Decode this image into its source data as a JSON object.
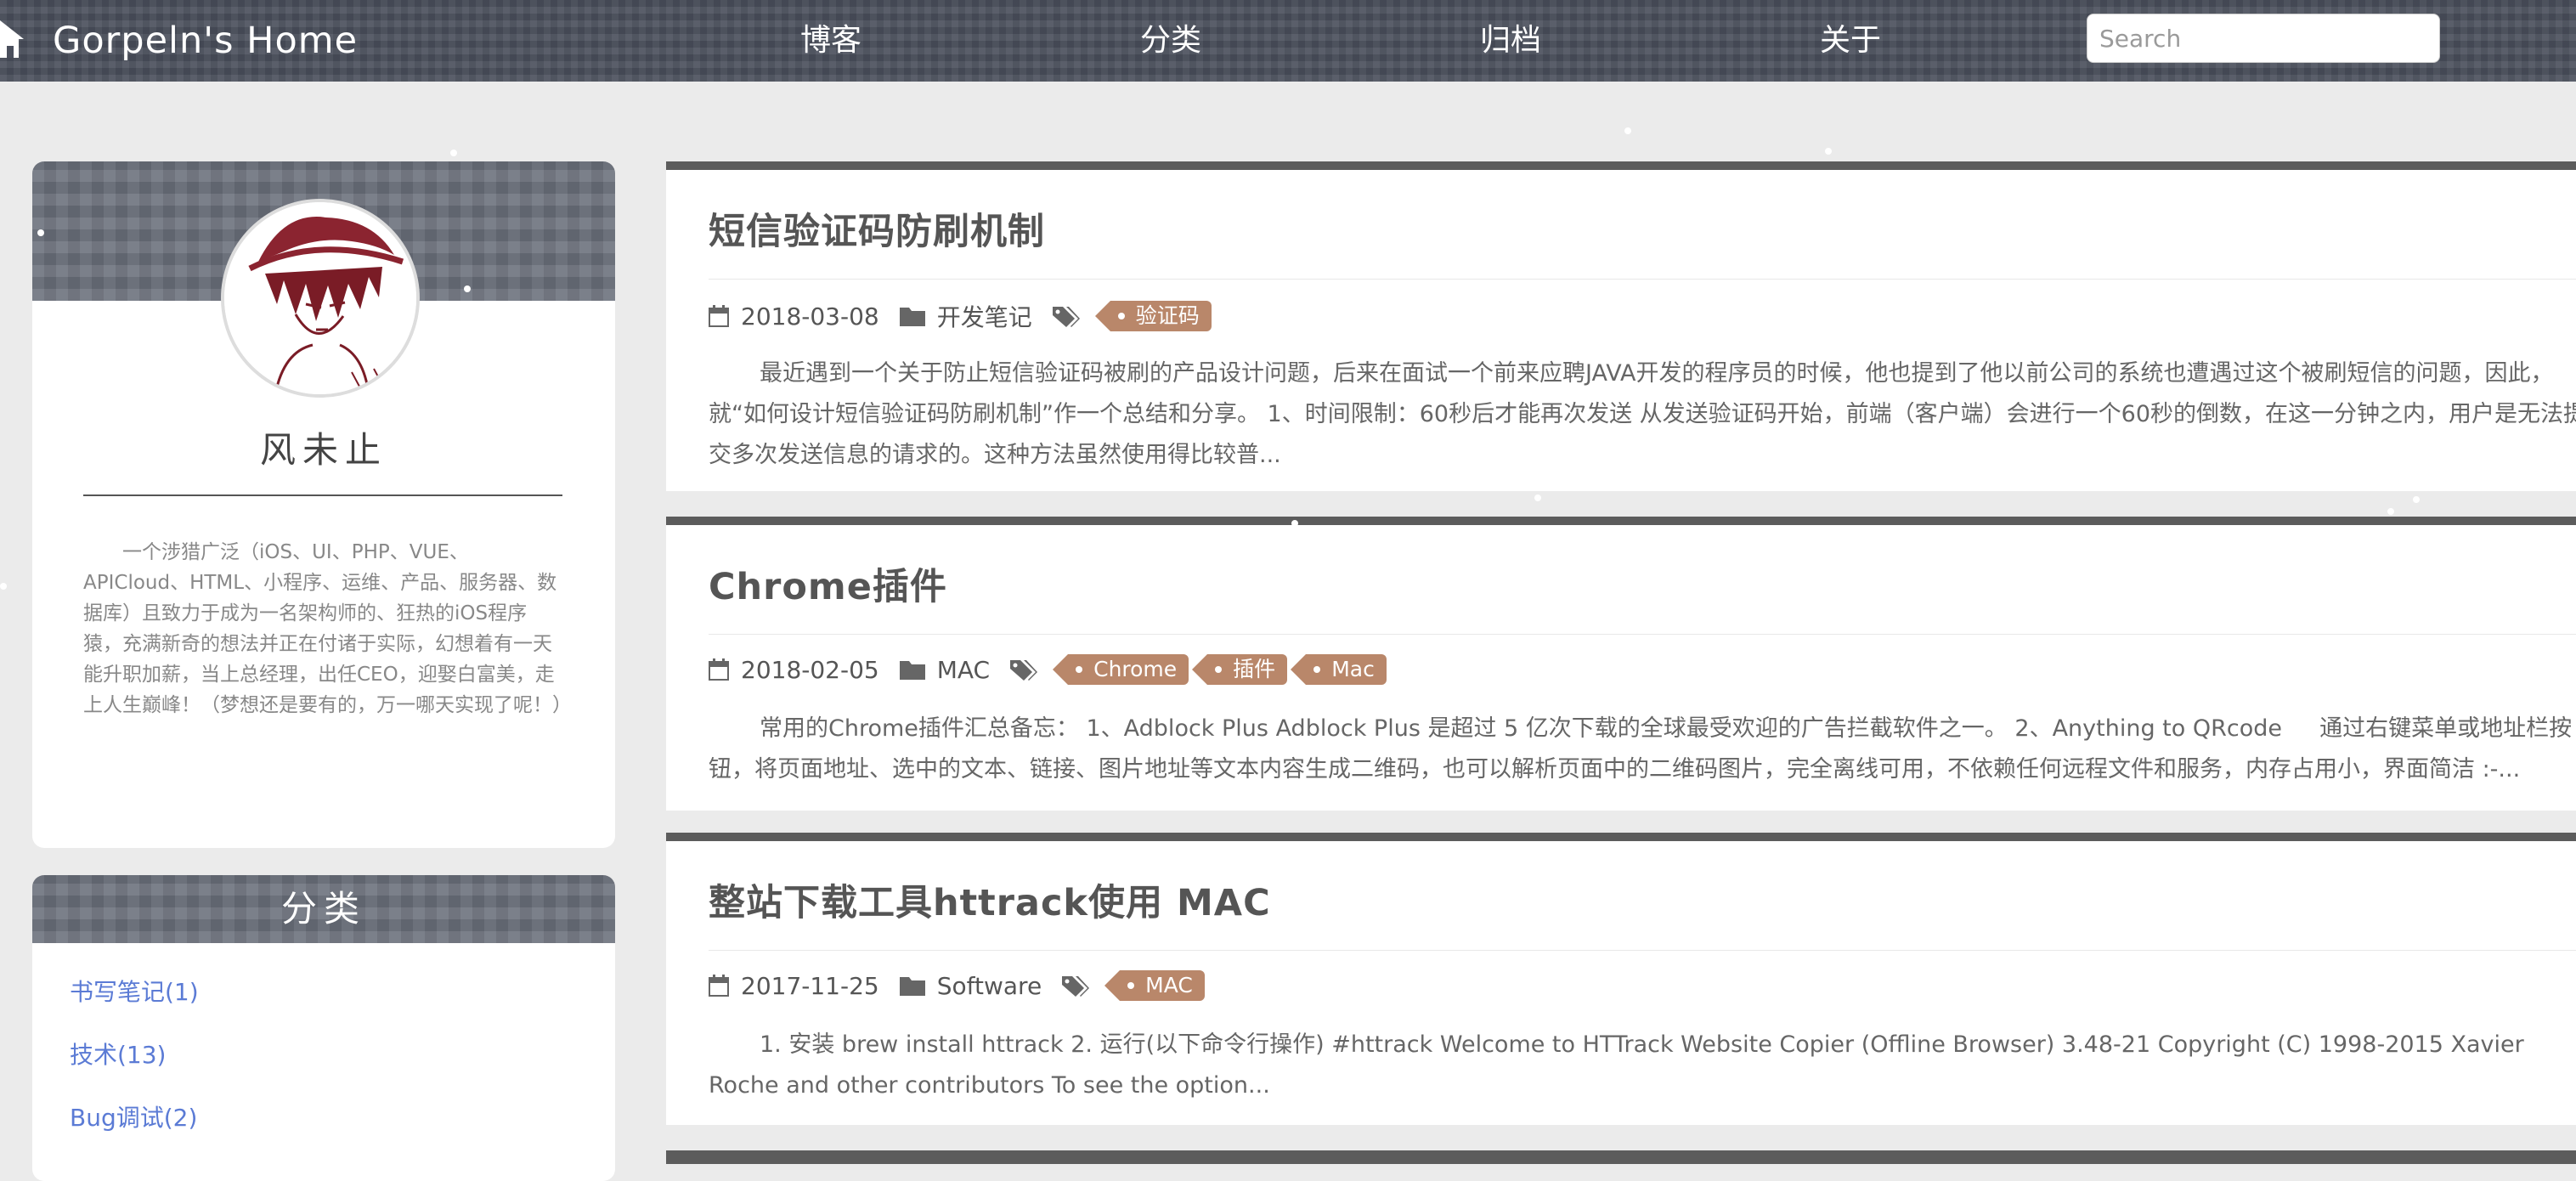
{
  "header": {
    "brand": "Gorpeln's Home",
    "nav": [
      "博客",
      "分类",
      "归档",
      "关于"
    ],
    "search_placeholder": "Search"
  },
  "profile": {
    "name": "风未止",
    "bio": "一个涉猎广泛（iOS、UI、PHP、VUE、APICloud、HTML、小程序、运维、产品、服务器、数据库）且致力于成为一名架构师的、狂热的iOS程序猿，充满新奇的想法并正在付诸于实际，幻想着有一天能升职加薪，当上总经理，出任CEO，迎娶白富美，走上人生巅峰！（梦想还是要有的，万一哪天实现了呢！）"
  },
  "categories": {
    "title": "分类",
    "items": [
      "书写笔记(1)",
      "技术(13)",
      "Bug调试(2)"
    ]
  },
  "posts": [
    {
      "title": "短信验证码防刷机制",
      "date": "2018-03-08",
      "category": "开发笔记",
      "tags": [
        "验证码"
      ],
      "excerpt": "最近遇到一个关于防止短信验证码被刷的产品设计问题，后来在面试一个前来应聘JAVA开发的程序员的时候，他也提到了他以前公司的系统也遭遇过这个被刷短信的问题，因此，就“如何设计短信验证码防刷机制”作一个总结和分享。 1、时间限制：60秒后才能再次发送 从发送验证码开始，前端（客户端）会进行一个60秒的倒数，在这一分钟之内，用户是无法提交多次发送信息的请求的。这种方法虽然使用得比较普..."
    },
    {
      "title": "Chrome插件",
      "date": "2018-02-05",
      "category": "MAC",
      "tags": [
        "Chrome",
        "插件",
        "Mac"
      ],
      "excerpt": "常用的Chrome插件汇总备忘： 1、Adblock Plus Adblock Plus 是超过 5 亿次下载的全球最受欢迎的广告拦截软件之一。 2、Anything to QRcode 　 通过右键菜单或地址栏按钮，将页面地址、选中的文本、链接、图片地址等文本内容生成二维码，也可以解析页面中的二维码图片，完全离线可用，不依赖任何远程文件和服务，内存占用小，界面简洁 :-..."
    },
    {
      "title": "整站下载工具httrack使用 MAC",
      "date": "2017-11-25",
      "category": "Software",
      "tags": [
        "MAC"
      ],
      "excerpt": "1. 安装 brew install httrack 2. 运行(以下命令行操作) #httrack Welcome to HTTrack Website Copier (Offline Browser) 3.48-21 Copyright (C) 1998-2015 Xavier Roche and other contributors To see the option..."
    }
  ]
}
